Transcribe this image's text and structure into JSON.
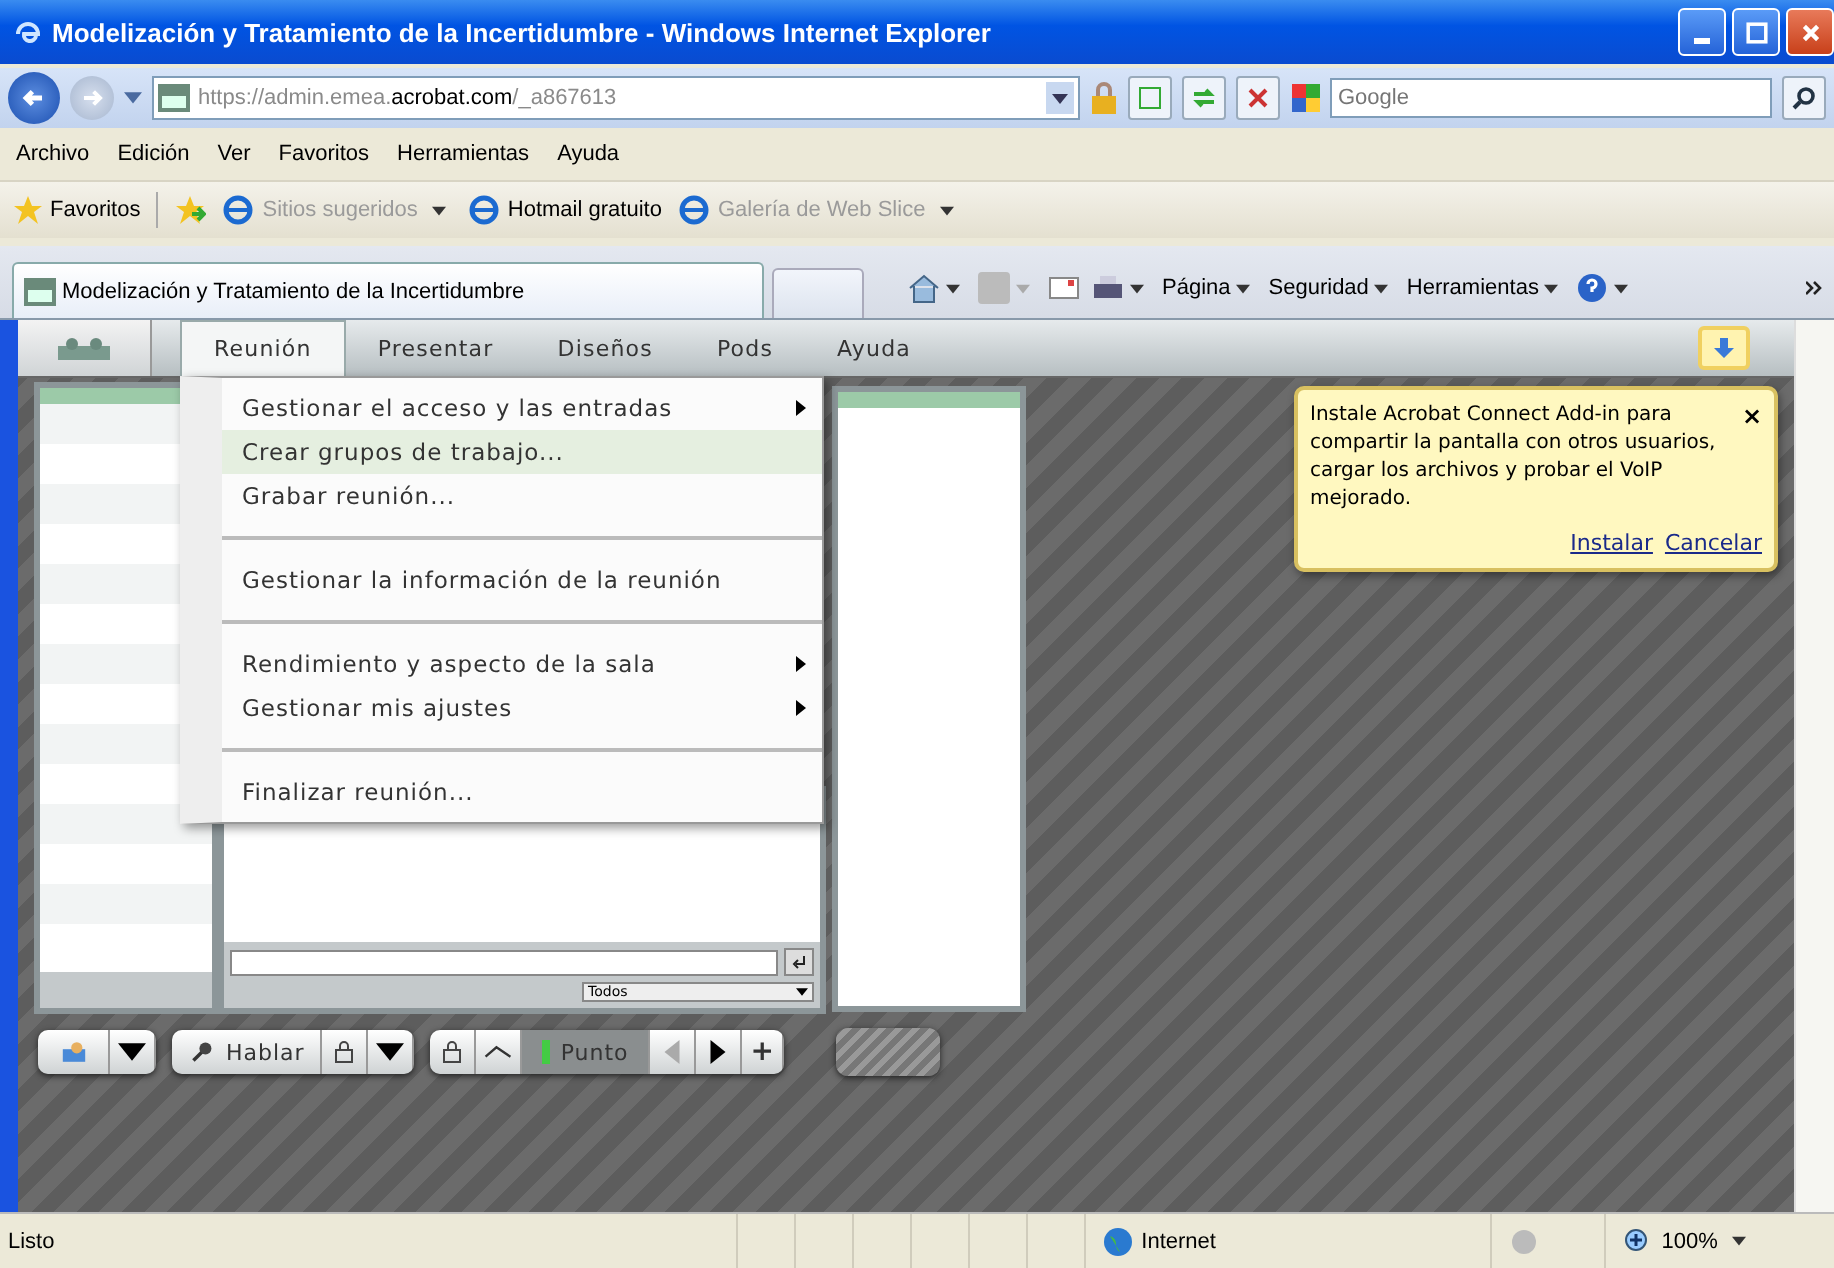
{
  "window": {
    "title": "Modelización y Tratamiento de la Incertidumbre - Windows Internet Explorer"
  },
  "address": {
    "segments": [
      {
        "text": "https://",
        "strong": false
      },
      {
        "text": "admin.emea.",
        "strong": false
      },
      {
        "text": "acrobat.com",
        "strong": true
      },
      {
        "text": "/_a867613",
        "strong": false
      }
    ]
  },
  "search": {
    "placeholder": "Google"
  },
  "menu_bar": [
    "Archivo",
    "Edición",
    "Ver",
    "Favoritos",
    "Herramientas",
    "Ayuda"
  ],
  "favorites_bar": {
    "label": "Favoritos",
    "links": [
      {
        "label": "Sitios sugeridos",
        "dimmed": true,
        "dropdown": true
      },
      {
        "label": "Hotmail gratuito",
        "dimmed": false,
        "dropdown": false
      },
      {
        "label": "Galería de Web Slice",
        "dimmed": true,
        "dropdown": true
      }
    ]
  },
  "tab": {
    "title": "Modelización y Tratamiento de la Incertidumbre"
  },
  "command_bar": [
    "Página",
    "Seguridad",
    "Herramientas"
  ],
  "app_menu": [
    {
      "label": "Reunión",
      "selected": true
    },
    {
      "label": "Presentar",
      "selected": false
    },
    {
      "label": "Diseños",
      "selected": false
    },
    {
      "label": "Pods",
      "selected": false
    },
    {
      "label": "Ayuda",
      "selected": false
    }
  ],
  "open_menu": [
    {
      "label": "Gestionar el acceso y las entradas",
      "submenu": true,
      "highlighted": false,
      "separator_before": false
    },
    {
      "label": "Crear grupos de trabajo...",
      "submenu": false,
      "highlighted": true,
      "separator_before": false
    },
    {
      "label": "Grabar reunión...",
      "submenu": false,
      "highlighted": false,
      "separator_before": false
    },
    {
      "label": "Gestionar la información de la reunión",
      "submenu": false,
      "highlighted": false,
      "separator_before": true
    },
    {
      "label": "Rendimiento y aspecto de la sala",
      "submenu": true,
      "highlighted": false,
      "separator_before": true
    },
    {
      "label": "Gestionar mis ajustes",
      "submenu": true,
      "highlighted": false,
      "separator_before": false
    },
    {
      "label": "Finalizar reunión...",
      "submenu": false,
      "highlighted": false,
      "separator_before": true
    }
  ],
  "addin_popup": {
    "text": "Instale Acrobat Connect Add-in para compartir la pantalla con otros usuarios, cargar los archivos y probar el VoIP mejorado.",
    "close": "×",
    "links": [
      "Instalar",
      "Cancelar"
    ]
  },
  "chat": {
    "recipient": "Todos"
  },
  "toolbar": {
    "talk": "Hablar",
    "pointer": "Punto",
    "add": "+"
  },
  "status_bar": {
    "text": "Listo",
    "zone": "Internet",
    "zoom": "100%"
  }
}
